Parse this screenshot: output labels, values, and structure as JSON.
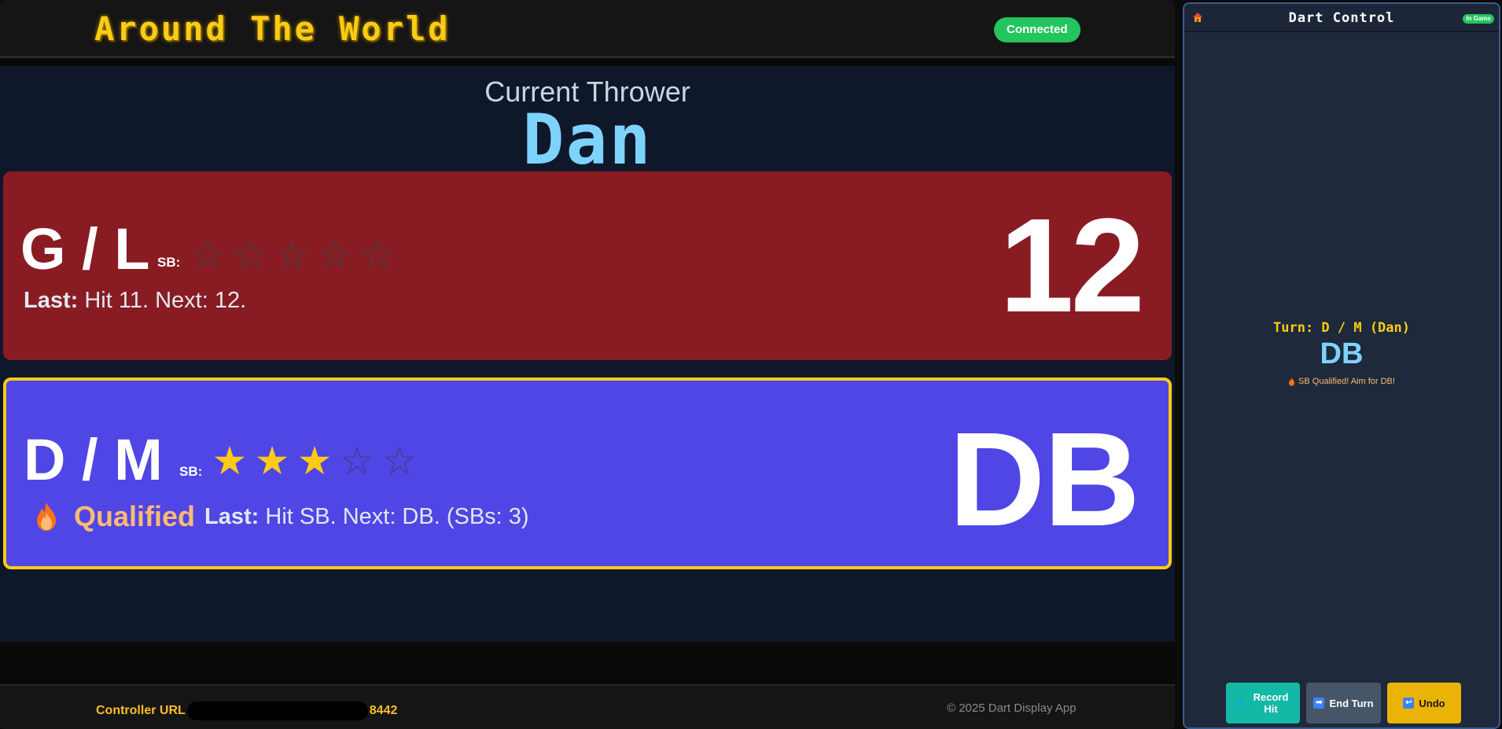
{
  "app": {
    "title": "Around The World",
    "connection_status": "Connected",
    "connection_color": "#22c55e"
  },
  "current_thrower": {
    "heading": "Current Thrower",
    "name": "Dan"
  },
  "teams": [
    {
      "name": "G / L",
      "sb_label": "SB:",
      "stars_filled": 0,
      "stars_total": 5,
      "qualified": false,
      "last_label": "Last:",
      "last_text": "Hit 11. Next: 12.",
      "target": "12",
      "color": "#891c23",
      "active": false
    },
    {
      "name": "D / M",
      "sb_label": "SB:",
      "stars_filled": 3,
      "stars_total": 5,
      "qualified": true,
      "qualified_label": "Qualified",
      "qualified_icon": "fire-icon",
      "last_label": "Last:",
      "last_text": "Hit SB. Next: DB. (SBs: 3)",
      "target": "DB",
      "color": "#4f46e5",
      "active": true,
      "active_border_color": "#facc15"
    }
  ],
  "footer": {
    "controller_url_label": "Controller URL",
    "controller_url_suffix": "8442",
    "copyright": "© 2025 Dart Display App"
  },
  "control_panel": {
    "title": "Dart Control",
    "status_badge": "In Game",
    "turn_text": "Turn: D / M (Dan)",
    "target": "DB",
    "hint": "SB Qualified! Aim for DB!",
    "buttons": {
      "record_hit": "Record Hit",
      "end_turn": "End Turn",
      "undo": "Undo"
    }
  }
}
